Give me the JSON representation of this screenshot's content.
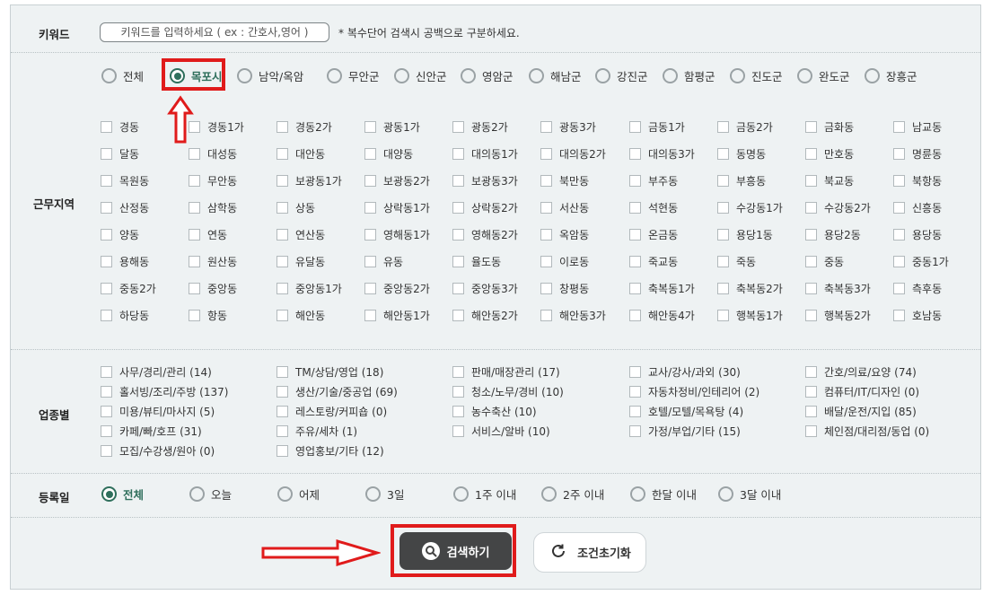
{
  "keyword": {
    "label": "키워드",
    "placeholder": "키워드를 입력하세요 ( ex : 간호사,영어 )",
    "note": "* 복수단어 검색시 공백으로 구분하세요."
  },
  "region": {
    "label": "근무지역",
    "cities": [
      {
        "label": "전체",
        "selected": false
      },
      {
        "label": "목포시",
        "selected": true
      },
      {
        "label": "남악/옥암",
        "selected": false
      },
      {
        "label": "무안군",
        "selected": false
      },
      {
        "label": "신안군",
        "selected": false
      },
      {
        "label": "영암군",
        "selected": false
      },
      {
        "label": "해남군",
        "selected": false
      },
      {
        "label": "강진군",
        "selected": false
      },
      {
        "label": "함평군",
        "selected": false
      },
      {
        "label": "진도군",
        "selected": false
      },
      {
        "label": "완도군",
        "selected": false
      },
      {
        "label": "장흥군",
        "selected": false
      }
    ],
    "districts": [
      "경동",
      "경동1가",
      "경동2가",
      "광동1가",
      "광동2가",
      "광동3가",
      "금동1가",
      "금동2가",
      "금화동",
      "남교동",
      "달동",
      "대성동",
      "대안동",
      "대양동",
      "대의동1가",
      "대의동2가",
      "대의동3가",
      "동명동",
      "만호동",
      "명륜동",
      "목원동",
      "무안동",
      "보광동1가",
      "보광동2가",
      "보광동3가",
      "북만동",
      "부주동",
      "부흥동",
      "북교동",
      "북항동",
      "산정동",
      "삼학동",
      "상동",
      "상락동1가",
      "상락동2가",
      "서산동",
      "석현동",
      "수강동1가",
      "수강동2가",
      "신흥동",
      "양동",
      "연동",
      "연산동",
      "영해동1가",
      "영해동2가",
      "옥암동",
      "온금동",
      "용당1동",
      "용당2동",
      "용당동",
      "용해동",
      "원산동",
      "유달동",
      "유동",
      "율도동",
      "이로동",
      "죽교동",
      "죽동",
      "중동",
      "중동1가",
      "중동2가",
      "중앙동",
      "중앙동1가",
      "중앙동2가",
      "중앙동3가",
      "창평동",
      "축복동1가",
      "축복동2가",
      "축복동3가",
      "측후동",
      "하당동",
      "항동",
      "해안동",
      "해안동1가",
      "해안동2가",
      "해안동3가",
      "해안동4가",
      "행복동1가",
      "행복동2가",
      "호남동"
    ]
  },
  "industry": {
    "label": "업종별",
    "items": [
      "사무/경리/관리 (14)",
      "TM/상담/영업 (18)",
      "판매/매장관리 (17)",
      "교사/강사/과외 (30)",
      "간호/의료/요양 (74)",
      "홀서빙/조리/주방 (137)",
      "생산/기술/중공업 (69)",
      "청소/노무/경비 (10)",
      "자동차정비/인테리어 (2)",
      "컴퓨터/IT/디자인 (0)",
      "미용/뷰티/마사지 (5)",
      "레스토랑/커피숍 (0)",
      "농수축산 (10)",
      "호텔/모텔/목욕탕 (4)",
      "배달/운전/지입 (85)",
      "카페/빠/호프 (31)",
      "주유/세차 (1)",
      "서비스/알바 (10)",
      "가정/부업/기타 (15)",
      "체인점/대리점/동업 (0)",
      "모집/수강생/원아 (0)",
      "영업홍보/기타 (12)"
    ]
  },
  "date": {
    "label": "등록일",
    "options": [
      {
        "label": "전체",
        "selected": true
      },
      {
        "label": "오늘",
        "selected": false
      },
      {
        "label": "어제",
        "selected": false
      },
      {
        "label": "3일",
        "selected": false
      },
      {
        "label": "1주 이내",
        "selected": false
      },
      {
        "label": "2주 이내",
        "selected": false
      },
      {
        "label": "한달 이내",
        "selected": false
      },
      {
        "label": "3달 이내",
        "selected": false
      }
    ]
  },
  "buttons": {
    "search": "검색하기",
    "reset": "조건초기화"
  },
  "colors": {
    "accent": "#2f6f5c",
    "annotation_red": "#e01b1b",
    "search_button": "#444546",
    "panel_bg": "#eef2f3"
  }
}
